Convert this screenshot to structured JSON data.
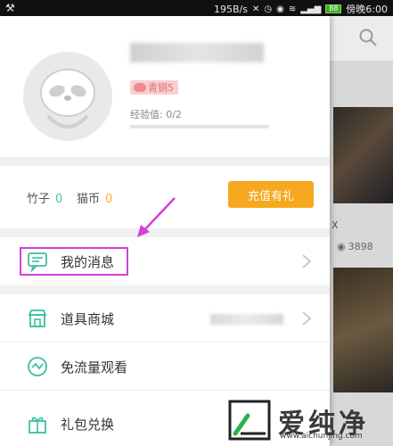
{
  "status_bar": {
    "network_speed": "195B/s",
    "time": "傍晚6:00",
    "battery_label": "88"
  },
  "profile": {
    "level_badge": "青铜5",
    "exp_label": "经验值",
    "exp_value": "0/2",
    "exp_progress": 0
  },
  "currency": {
    "bamboo_label": "竹子",
    "bamboo_value": "0",
    "catcoin_label": "猫币",
    "catcoin_value": "0",
    "recharge_label": "充值有礼"
  },
  "menu": {
    "items": [
      {
        "label": "我的消息",
        "icon": "message-icon"
      },
      {
        "label": "道具商城",
        "icon": "store-icon"
      },
      {
        "label": "免流量观看",
        "icon": "free-data-icon"
      },
      {
        "label": "礼包兑换",
        "icon": "gift-icon"
      }
    ]
  },
  "background_page": {
    "view_count": "3898"
  },
  "watermark": {
    "text": "爱纯净",
    "url": "www.aichunjing.com"
  },
  "colors": {
    "accent_orange": "#f7a81e",
    "accent_green": "#4ac3a5",
    "highlight_magenta": "#d43fd9"
  }
}
